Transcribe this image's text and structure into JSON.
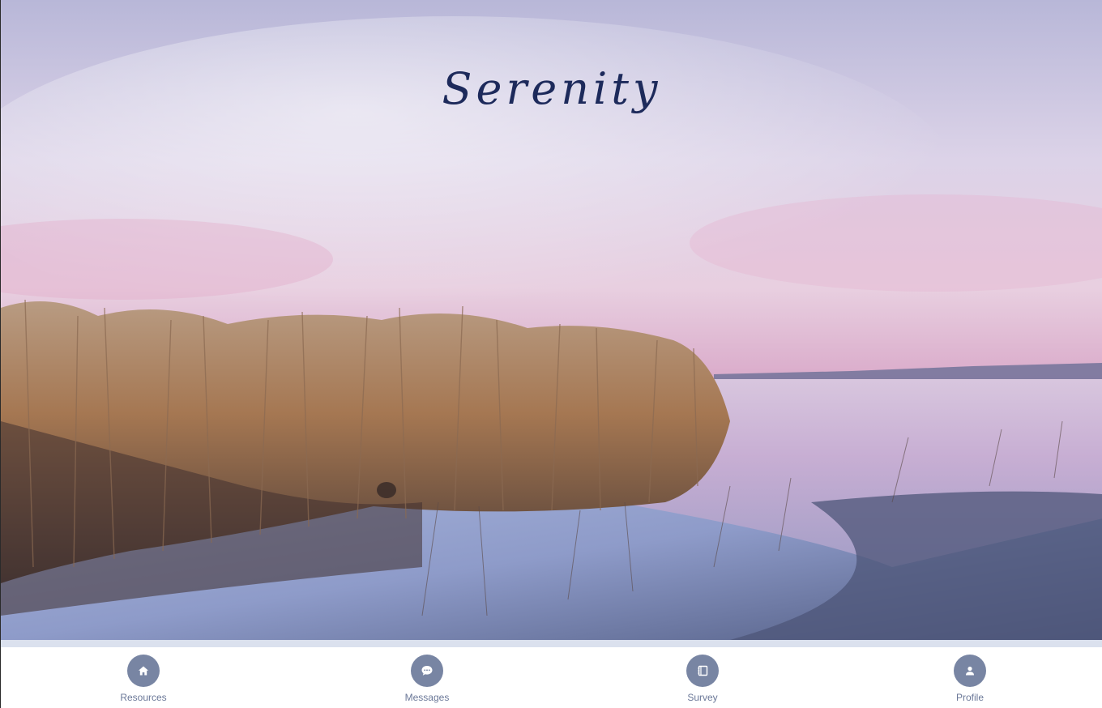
{
  "app": {
    "title": "Serenity"
  },
  "bottom_nav": {
    "items": [
      {
        "label": "Resources",
        "icon": "home-icon"
      },
      {
        "label": "Messages",
        "icon": "chat-bubble-icon"
      },
      {
        "label": "Survey",
        "icon": "notebook-icon"
      },
      {
        "label": "Profile",
        "icon": "user-icon"
      }
    ]
  },
  "colors": {
    "title": "#1d2a5b",
    "nav_icon_bg": "#7885a3",
    "nav_label": "#6b7898",
    "strip": "#dbe1ee"
  }
}
